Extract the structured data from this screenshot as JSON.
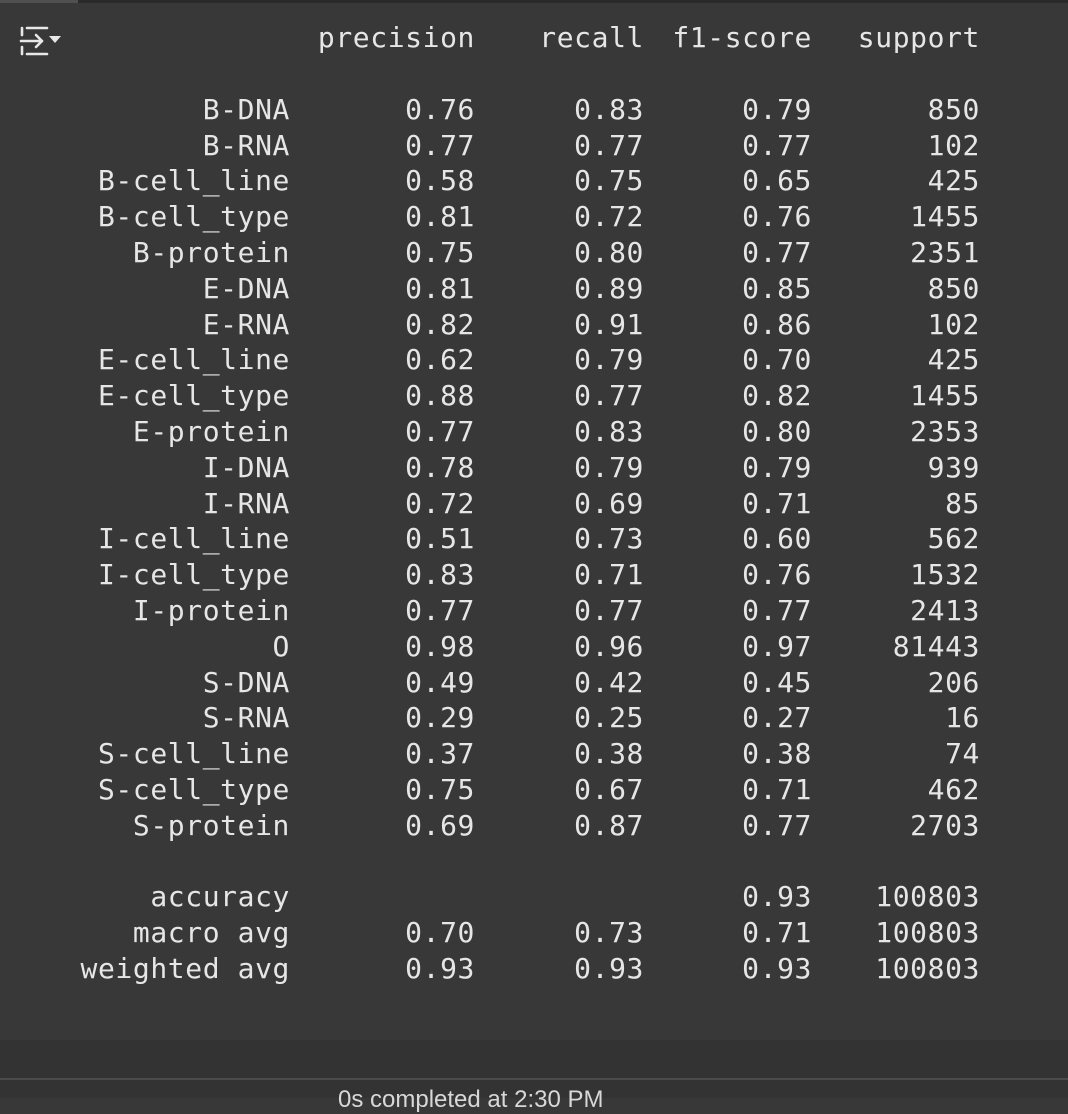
{
  "toolbar": {
    "toggle_icon": "output-collapse-icon"
  },
  "report": {
    "columns": [
      "precision",
      "recall",
      "f1-score",
      "support"
    ],
    "rows": [
      {
        "label": "B-DNA",
        "precision": "0.76",
        "recall": "0.83",
        "f1": "0.79",
        "support": "850"
      },
      {
        "label": "B-RNA",
        "precision": "0.77",
        "recall": "0.77",
        "f1": "0.77",
        "support": "102"
      },
      {
        "label": "B-cell_line",
        "precision": "0.58",
        "recall": "0.75",
        "f1": "0.65",
        "support": "425"
      },
      {
        "label": "B-cell_type",
        "precision": "0.81",
        "recall": "0.72",
        "f1": "0.76",
        "support": "1455"
      },
      {
        "label": "B-protein",
        "precision": "0.75",
        "recall": "0.80",
        "f1": "0.77",
        "support": "2351"
      },
      {
        "label": "E-DNA",
        "precision": "0.81",
        "recall": "0.89",
        "f1": "0.85",
        "support": "850"
      },
      {
        "label": "E-RNA",
        "precision": "0.82",
        "recall": "0.91",
        "f1": "0.86",
        "support": "102"
      },
      {
        "label": "E-cell_line",
        "precision": "0.62",
        "recall": "0.79",
        "f1": "0.70",
        "support": "425"
      },
      {
        "label": "E-cell_type",
        "precision": "0.88",
        "recall": "0.77",
        "f1": "0.82",
        "support": "1455"
      },
      {
        "label": "E-protein",
        "precision": "0.77",
        "recall": "0.83",
        "f1": "0.80",
        "support": "2353"
      },
      {
        "label": "I-DNA",
        "precision": "0.78",
        "recall": "0.79",
        "f1": "0.79",
        "support": "939"
      },
      {
        "label": "I-RNA",
        "precision": "0.72",
        "recall": "0.69",
        "f1": "0.71",
        "support": "85"
      },
      {
        "label": "I-cell_line",
        "precision": "0.51",
        "recall": "0.73",
        "f1": "0.60",
        "support": "562"
      },
      {
        "label": "I-cell_type",
        "precision": "0.83",
        "recall": "0.71",
        "f1": "0.76",
        "support": "1532"
      },
      {
        "label": "I-protein",
        "precision": "0.77",
        "recall": "0.77",
        "f1": "0.77",
        "support": "2413"
      },
      {
        "label": "O",
        "precision": "0.98",
        "recall": "0.96",
        "f1": "0.97",
        "support": "81443"
      },
      {
        "label": "S-DNA",
        "precision": "0.49",
        "recall": "0.42",
        "f1": "0.45",
        "support": "206"
      },
      {
        "label": "S-RNA",
        "precision": "0.29",
        "recall": "0.25",
        "f1": "0.27",
        "support": "16"
      },
      {
        "label": "S-cell_line",
        "precision": "0.37",
        "recall": "0.38",
        "f1": "0.38",
        "support": "74"
      },
      {
        "label": "S-cell_type",
        "precision": "0.75",
        "recall": "0.67",
        "f1": "0.71",
        "support": "462"
      },
      {
        "label": "S-protein",
        "precision": "0.69",
        "recall": "0.87",
        "f1": "0.77",
        "support": "2703"
      }
    ],
    "summary": [
      {
        "label": "accuracy",
        "precision": "",
        "recall": "",
        "f1": "0.93",
        "support": "100803"
      },
      {
        "label": "macro avg",
        "precision": "0.70",
        "recall": "0.73",
        "f1": "0.71",
        "support": "100803"
      },
      {
        "label": "weighted avg",
        "precision": "0.93",
        "recall": "0.93",
        "f1": "0.93",
        "support": "100803"
      }
    ]
  },
  "status": {
    "text": "0s completed at 2:30 PM"
  },
  "colors": {
    "background": "#383838",
    "text": "#e6e6e6"
  }
}
